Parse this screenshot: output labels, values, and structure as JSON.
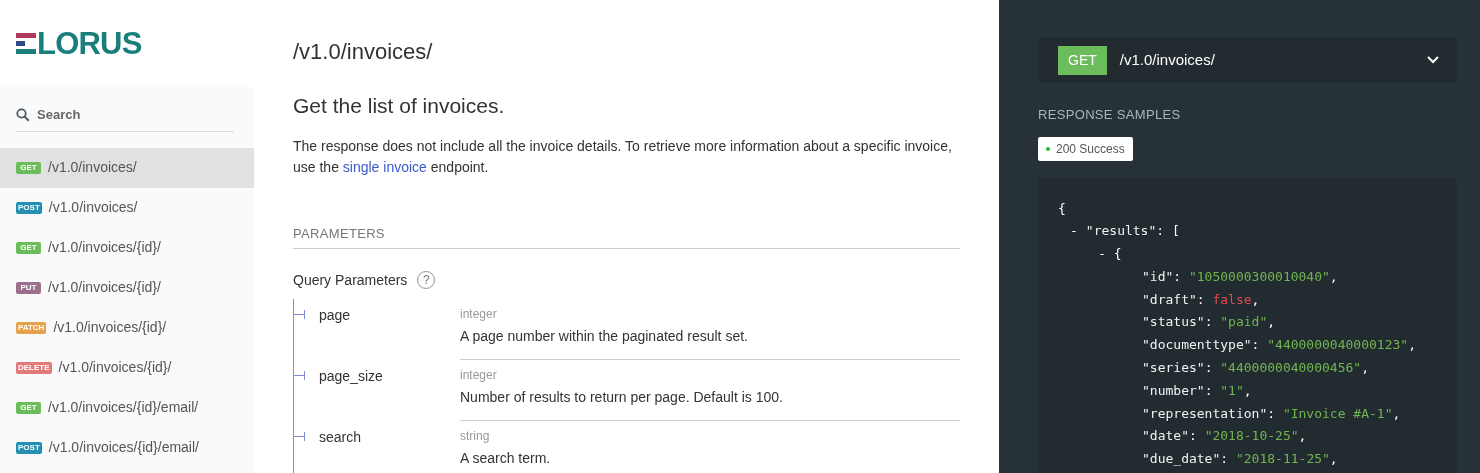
{
  "logo": {
    "text": "LORUS"
  },
  "search": {
    "placeholder": "Search"
  },
  "sidebar": {
    "items": [
      {
        "method": "GET",
        "path": "/v1.0/invoices/",
        "selected": true
      },
      {
        "method": "POST",
        "path": "/v1.0/invoices/",
        "selected": false
      },
      {
        "method": "GET",
        "path": "/v1.0/invoices/{id}/",
        "selected": false
      },
      {
        "method": "PUT",
        "path": "/v1.0/invoices/{id}/",
        "selected": false
      },
      {
        "method": "PATCH",
        "path": "/v1.0/invoices/{id}/",
        "selected": false
      },
      {
        "method": "DELETE",
        "path": "/v1.0/invoices/{id}/",
        "selected": false
      },
      {
        "method": "GET",
        "path": "/v1.0/invoices/{id}/email/",
        "selected": false
      },
      {
        "method": "POST",
        "path": "/v1.0/invoices/{id}/email/",
        "selected": false
      }
    ]
  },
  "main": {
    "title": "/v1.0/invoices/",
    "subtitle": "Get the list of invoices.",
    "description": {
      "before": "The response does not include all the invoice details. To retrieve more information about a specific invoice, use the ",
      "link": "single invoice",
      "after": " endpoint."
    },
    "section": "PARAMETERS",
    "query_title": "Query Parameters",
    "help": "?",
    "params": [
      {
        "name": "page",
        "type": "integer",
        "description": "A page number within the paginated result set."
      },
      {
        "name": "page_size",
        "type": "integer",
        "description": "Number of results to return per page. Default is 100."
      },
      {
        "name": "search",
        "type": "string",
        "description": "A search term."
      }
    ]
  },
  "right": {
    "method": "GET",
    "path": "/v1.0/invoices/",
    "samples_title": "RESPONSE SAMPLES",
    "response_tab": "200 Success",
    "code": [
      {
        "tokens": [
          {
            "kind": "punct",
            "text": "{"
          }
        ],
        "children": [
          {
            "tokens": [
              {
                "kind": "toggle",
                "text": "-"
              },
              {
                "kind": "key",
                "text": "\"results\""
              },
              {
                "kind": "punct",
                "text": ": ["
              }
            ],
            "children": [
              {
                "tokens": [
                  {
                    "kind": "toggle",
                    "text": "-"
                  },
                  {
                    "kind": "punct",
                    "text": "{"
                  }
                ],
                "children": [
                  {
                    "tokens": [
                      {
                        "kind": "key",
                        "text": "\"id\""
                      },
                      {
                        "kind": "punct",
                        "text": ": "
                      },
                      {
                        "kind": "string",
                        "text": "\"1050000300010040\""
                      },
                      {
                        "kind": "punct",
                        "text": ","
                      }
                    ]
                  },
                  {
                    "tokens": [
                      {
                        "kind": "key",
                        "text": "\"draft\""
                      },
                      {
                        "kind": "punct",
                        "text": ": "
                      },
                      {
                        "kind": "boolean",
                        "text": "false"
                      },
                      {
                        "kind": "punct",
                        "text": ","
                      }
                    ]
                  },
                  {
                    "tokens": [
                      {
                        "kind": "key",
                        "text": "\"status\""
                      },
                      {
                        "kind": "punct",
                        "text": ": "
                      },
                      {
                        "kind": "string",
                        "text": "\"paid\""
                      },
                      {
                        "kind": "punct",
                        "text": ","
                      }
                    ]
                  },
                  {
                    "tokens": [
                      {
                        "kind": "key",
                        "text": "\"documenttype\""
                      },
                      {
                        "kind": "punct",
                        "text": ": "
                      },
                      {
                        "kind": "string",
                        "text": "\"4400000040000123\""
                      },
                      {
                        "kind": "punct",
                        "text": ","
                      }
                    ]
                  },
                  {
                    "tokens": [
                      {
                        "kind": "key",
                        "text": "\"series\""
                      },
                      {
                        "kind": "punct",
                        "text": ": "
                      },
                      {
                        "kind": "string",
                        "text": "\"4400000040000456\""
                      },
                      {
                        "kind": "punct",
                        "text": ","
                      }
                    ]
                  },
                  {
                    "tokens": [
                      {
                        "kind": "key",
                        "text": "\"number\""
                      },
                      {
                        "kind": "punct",
                        "text": ": "
                      },
                      {
                        "kind": "string",
                        "text": "\"1\""
                      },
                      {
                        "kind": "punct",
                        "text": ","
                      }
                    ]
                  },
                  {
                    "tokens": [
                      {
                        "kind": "key",
                        "text": "\"representation\""
                      },
                      {
                        "kind": "punct",
                        "text": ": "
                      },
                      {
                        "kind": "string",
                        "text": "\"Invoice #A-1\""
                      },
                      {
                        "kind": "punct",
                        "text": ","
                      }
                    ]
                  },
                  {
                    "tokens": [
                      {
                        "kind": "key",
                        "text": "\"date\""
                      },
                      {
                        "kind": "punct",
                        "text": ": "
                      },
                      {
                        "kind": "string",
                        "text": "\"2018-10-25\""
                      },
                      {
                        "kind": "punct",
                        "text": ","
                      }
                    ]
                  },
                  {
                    "tokens": [
                      {
                        "kind": "key",
                        "text": "\"due_date\""
                      },
                      {
                        "kind": "punct",
                        "text": ": "
                      },
                      {
                        "kind": "string",
                        "text": "\"2018-11-25\""
                      },
                      {
                        "kind": "punct",
                        "text": ","
                      }
                    ]
                  }
                ]
              }
            ]
          }
        ]
      }
    ]
  }
}
